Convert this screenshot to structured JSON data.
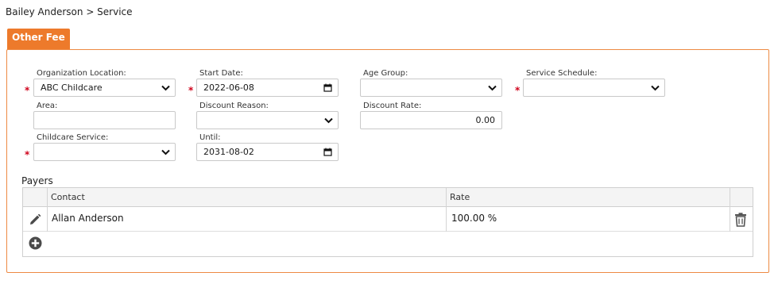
{
  "breadcrumb": {
    "text": "Bailey Anderson > Service"
  },
  "tab": {
    "label": "Other Fee"
  },
  "form": {
    "organization_location": {
      "label": "Organization Location:",
      "value": "ABC Childcare",
      "required_mark": "*"
    },
    "start_date": {
      "label": "Start Date:",
      "value": "2022-06-08",
      "required_mark": "*"
    },
    "age_group": {
      "label": "Age Group:",
      "value": ""
    },
    "service_schedule": {
      "label": "Service Schedule:",
      "value": "",
      "required_mark": "*"
    },
    "area": {
      "label": "Area:",
      "value": ""
    },
    "discount_reason": {
      "label": "Discount Reason:",
      "value": ""
    },
    "discount_rate": {
      "label": "Discount Rate:",
      "value": "0.00"
    },
    "childcare_service": {
      "label": "Childcare Service:",
      "value": "",
      "required_mark": "*"
    },
    "until": {
      "label": "Until:",
      "value": "2031-08-02"
    }
  },
  "payers": {
    "title": "Payers",
    "columns": {
      "contact": "Contact",
      "rate": "Rate"
    },
    "rows": [
      {
        "contact": "Allan Anderson",
        "rate": "100.00 %"
      }
    ]
  },
  "icons": {
    "edit": "pencil-icon",
    "delete": "trash-icon",
    "add": "plus-circle-icon",
    "dropdown": "chevron-down-icon",
    "date": "calendar-icon"
  },
  "colors": {
    "accent": "#ed7a2b",
    "required": "#d0021b"
  }
}
